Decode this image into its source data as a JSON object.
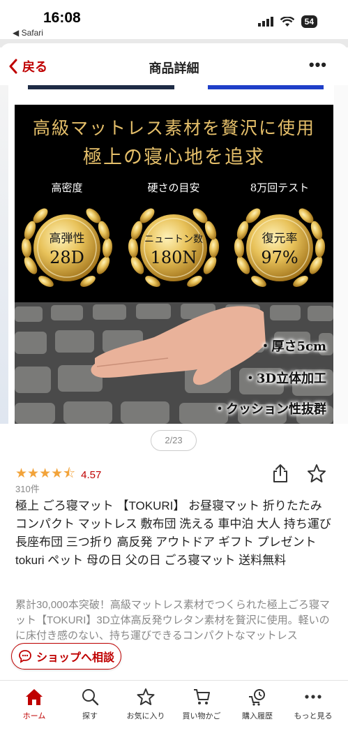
{
  "status_bar": {
    "time": "16:08",
    "back_app": "◀ Safari",
    "battery": "54"
  },
  "nav": {
    "back_label": "戻る",
    "title": "商品詳細",
    "more": "•••"
  },
  "hero": {
    "headline_1": "高級マットレス素材を贅沢に使用",
    "headline_2": "極上の寝心地を追求",
    "badges": [
      {
        "caption": "高密度",
        "label": "高弾性",
        "value": "28D"
      },
      {
        "caption": "硬さの目安",
        "label": "ニュートン数",
        "value": "180N"
      },
      {
        "caption": "8万回テスト",
        "label": "復元率",
        "value": "97%"
      }
    ],
    "features": [
      "・厚さ5cm",
      "・3D立体加工",
      "・クッション性抜群"
    ]
  },
  "pager": "2/23",
  "rating": {
    "stars": "★★★★⯪",
    "value": "4.57",
    "count": "310件"
  },
  "product_title": "極上 ごろ寝マット 【TOKURI】 お昼寝マット 折りたたみ コンパクト マットレス 敷布団 洗える 車中泊 大人 持ち運び 長座布団 三つ折り 高反発 アウトドア ギフト プレゼント tokuri ペット 母の日 父の日 ごろ寝マット 送料無料",
  "description": "累計30,000本突破！高級マットレス素材でつくられた極上ごろ寝マット【TOKURI】3D立体高反発ウレタン素材を贅沢に使用。軽いのに床付き感のない、持ち運びできるコンパクトなマットレス",
  "shop_chat_label": "ショップへ相談",
  "tabs": [
    {
      "label": "ホーム",
      "icon": "home-icon",
      "active": true
    },
    {
      "label": "探す",
      "icon": "search-icon",
      "active": false
    },
    {
      "label": "お気に入り",
      "icon": "star-icon",
      "active": false
    },
    {
      "label": "買い物かご",
      "icon": "cart-icon",
      "active": false
    },
    {
      "label": "購入履歴",
      "icon": "history-icon",
      "active": false
    },
    {
      "label": "もっと見る",
      "icon": "more-icon",
      "active": false
    }
  ],
  "colors": {
    "accent": "#bf0000",
    "gold": "#e5bf6a",
    "star": "#f2a33a"
  }
}
